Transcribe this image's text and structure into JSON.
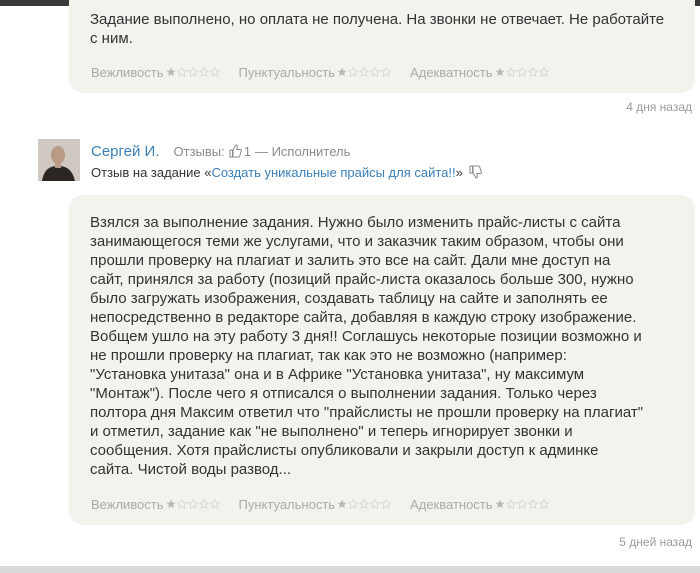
{
  "review1": {
    "text": "Задание выполнено, но оплата не получена. На звонки не отвечает. Не работайте с ним.",
    "ratings": [
      {
        "label": "Вежливость",
        "stars": 1,
        "max": 5
      },
      {
        "label": "Пунктуальность",
        "stars": 1,
        "max": 5
      },
      {
        "label": "Адекватность",
        "stars": 1,
        "max": 5
      }
    ],
    "date": "4 дня назад"
  },
  "review2": {
    "author": "Сергей И.",
    "reviews_label": "Отзывы:",
    "reviews_count": "1",
    "role": "— Исполнитель",
    "task_prefix": "Отзыв на задание «",
    "task_link": "Создать уникальные прайсы для сайта!!",
    "task_suffix": "»",
    "text": "Взялся за выполнение задания. Нужно было изменить прайс-листы с сайта\nзанимающегося теми же услугами, что и заказчик таким образом, чтобы они\nпрошли проверку на плагиат и залить это все на сайт. Дали мне доступ на\nсайт, принялся за работу (позиций прайс-листа оказалось больше 300, нужно\nбыло загружать изображения, создавать таблицу на сайте и заполнять ее\nнепосредственно в редакторе сайта, добавляя в каждую строку изображение.\nВобщем ушло на эту работу 3 дня!! Соглашусь некоторые позиции возможно и\nне прошли проверку на плагиат, так как это не возможно (например:\n\"Установка унитаза\" она и в Африке \"Установка унитаза\", ну максимум\n\"Монтаж\"). После чего я отписался о выполнении задания. Только через\nполтора дня Максим ответил что \"прайслисты не прошли проверку на плагиат\"\nи отметил, задание как \"не выполнено\" и теперь игнорирует звонки и\nсообщения. Хотя прайслисты опубликовали и закрыли доступ к админке\nсайта. Чистой воды развод...",
    "ratings": [
      {
        "label": "Вежливость",
        "stars": 1,
        "max": 5
      },
      {
        "label": "Пунктуальность",
        "stars": 1,
        "max": 5
      },
      {
        "label": "Адекватность",
        "stars": 1,
        "max": 5
      }
    ],
    "date": "5 дней назад"
  },
  "colors": {
    "link": "#3a7fb8",
    "bubble": "#f4f2ec",
    "star_filled": "#b8b8b8",
    "star_empty": "#d6d6d6"
  }
}
